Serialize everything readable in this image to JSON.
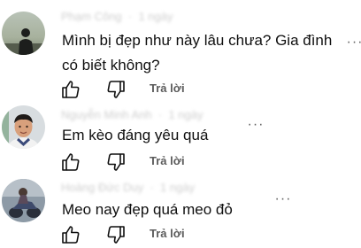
{
  "comments": [
    {
      "author": "Phạm Công",
      "time": "1 ngày",
      "text": "Mình bị đẹp như này lâu chưa? Gia đình có biết không?",
      "reply_label": "Trả lời",
      "avatar_icon": "person-silhouette-avatar"
    },
    {
      "author": "Nguyễn Minh Anh",
      "time": "1 ngày",
      "text": "Em kèo đáng yêu quá",
      "reply_label": "Trả lời",
      "avatar_icon": "man-portrait-avatar"
    },
    {
      "author": "Hoàng Đức Duy",
      "time": "1 ngày",
      "text": "Meo nay đẹp quá meo đỏ",
      "reply_label": "Trả lời",
      "avatar_icon": "motorbike-avatar"
    }
  ],
  "icons": {
    "like": "thumbs-up-icon",
    "dislike": "thumbs-down-icon",
    "more": "more-vertical-icon"
  },
  "colors": {
    "text": "#0f0f0f",
    "secondary": "#606060",
    "meta_blurred": "#cfcfcf"
  }
}
